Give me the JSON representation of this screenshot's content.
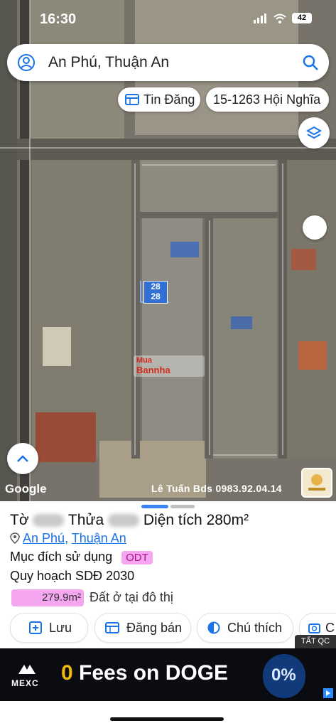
{
  "status": {
    "time": "16:30",
    "battery": "42"
  },
  "search": {
    "query": "An Phú, Thuận An"
  },
  "chips": {
    "tin_dang": "Tin Đăng",
    "address": "15-1263 Hội Nghĩa"
  },
  "map": {
    "marker_top": "28",
    "marker_bottom": "28",
    "google_label": "Google",
    "credit": "Lê Tuấn Bds 0983.92.04.14",
    "watermark_line1": "Mua",
    "watermark_line2": "Bannha"
  },
  "parcel": {
    "title_prefix": "Tờ",
    "title_mid": "Thửa",
    "title_area": "Diện tích 280m²",
    "loc_ward": "An Phú",
    "loc_sep": ", ",
    "loc_district": "Thuận An",
    "purpose_label": "Mục đích sử dụng",
    "purpose_code": "ODT",
    "plan_label": "Quy hoạch SDĐ 2030",
    "land_area": "279.9m²",
    "land_label": "Đất ở tại đô thị"
  },
  "actions": {
    "save": "Lưu",
    "post": "Đăng bán",
    "legend": "Chú thích",
    "more": "C"
  },
  "ad": {
    "tag": "TẤT QC",
    "brand": "MEXC",
    "zero": "0",
    "headline": " Fees on DOGE",
    "badge": "0%"
  },
  "colors": {
    "accent": "#1a73e8",
    "odt_bg": "#f5a6f0",
    "odt_text": "#b0128f",
    "ad_bg": "#0a0c12",
    "ad_zero": "#f0b90b"
  }
}
